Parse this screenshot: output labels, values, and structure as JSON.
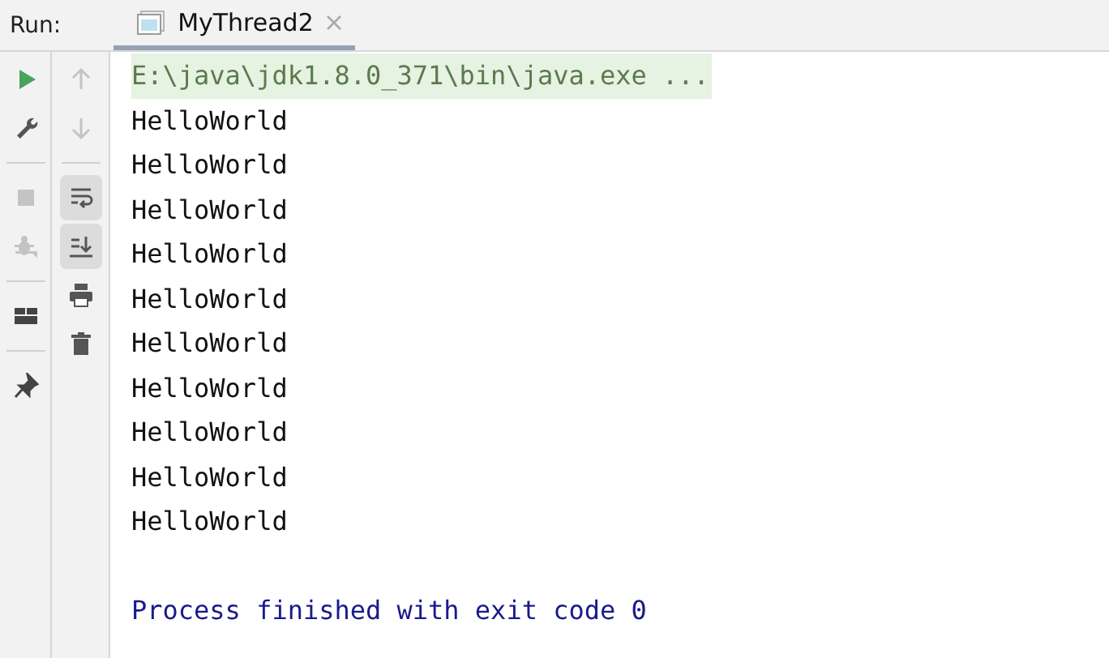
{
  "run_bar": {
    "label": "Run:",
    "tabs": [
      {
        "title": "MyThread2",
        "selected": true
      }
    ]
  },
  "toolbar_left": [
    {
      "kind": "run",
      "disabled": false
    },
    {
      "kind": "wrench",
      "disabled": false
    },
    {
      "kind": "divider"
    },
    {
      "kind": "stop",
      "disabled": true
    },
    {
      "kind": "debug",
      "disabled": true
    },
    {
      "kind": "divider"
    },
    {
      "kind": "layout",
      "disabled": false
    },
    {
      "kind": "divider"
    },
    {
      "kind": "pin",
      "disabled": false
    }
  ],
  "toolbar_right": [
    {
      "kind": "up",
      "disabled": true
    },
    {
      "kind": "down",
      "disabled": true
    },
    {
      "kind": "divider"
    },
    {
      "kind": "wrap",
      "on": true
    },
    {
      "kind": "scroll",
      "on": true
    },
    {
      "kind": "print",
      "on": false
    },
    {
      "kind": "trash",
      "on": false
    }
  ],
  "console": [
    {
      "kind": "command",
      "text": "E:\\java\\jdk1.8.0_371\\bin\\java.exe ..."
    },
    {
      "kind": "output",
      "text": "HelloWorld"
    },
    {
      "kind": "output",
      "text": "HelloWorld"
    },
    {
      "kind": "output",
      "text": "HelloWorld"
    },
    {
      "kind": "output",
      "text": "HelloWorld"
    },
    {
      "kind": "output",
      "text": "HelloWorld"
    },
    {
      "kind": "output",
      "text": "HelloWorld"
    },
    {
      "kind": "output",
      "text": "HelloWorld"
    },
    {
      "kind": "output",
      "text": "HelloWorld"
    },
    {
      "kind": "output",
      "text": "HelloWorld"
    },
    {
      "kind": "output",
      "text": "HelloWorld"
    },
    {
      "kind": "exit",
      "text": "Process finished with exit code 0"
    }
  ]
}
